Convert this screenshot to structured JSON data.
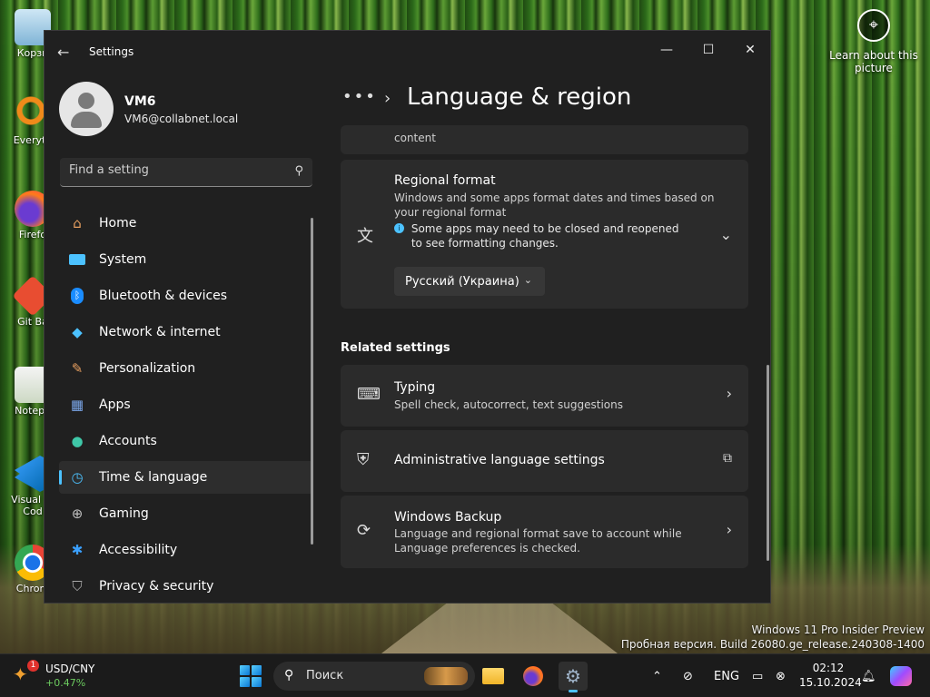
{
  "desktop": {
    "icons": [
      {
        "label": "Корзи",
        "icon": "recycle-bin-icon"
      },
      {
        "label": "Everyth",
        "icon": "everything-search-icon"
      },
      {
        "label": "Firefo",
        "icon": "firefox-icon"
      },
      {
        "label": "Git Ba",
        "icon": "git-bash-icon"
      },
      {
        "label": "Notepa",
        "icon": "notepad-plus-plus-icon"
      },
      {
        "label": "Visual St Cod",
        "icon": "vscode-icon"
      },
      {
        "label": "Chrom",
        "icon": "chrome-icon"
      }
    ],
    "learn_about": "Learn about this picture",
    "watermark_line1": "Windows 11 Pro Insider Preview",
    "watermark_line2": "Пробная версия. Build 26080.ge_release.240308-1400"
  },
  "window": {
    "title": "Settings",
    "controls": {
      "minimize": "—",
      "maximize": "☐",
      "close": "✕"
    }
  },
  "user": {
    "name": "VM6",
    "email": "VM6@collabnet.local"
  },
  "search": {
    "placeholder": "Find a setting"
  },
  "nav": {
    "items": [
      {
        "label": "Home",
        "icon": "home-icon",
        "color": "#e8a060"
      },
      {
        "label": "System",
        "icon": "monitor-icon",
        "color": "#4cc2ff"
      },
      {
        "label": "Bluetooth & devices",
        "icon": "bluetooth-icon",
        "color": "#1a8cff"
      },
      {
        "label": "Network & internet",
        "icon": "wifi-icon",
        "color": "#4cc2ff"
      },
      {
        "label": "Personalization",
        "icon": "brush-icon",
        "color": "#e8a060"
      },
      {
        "label": "Apps",
        "icon": "apps-icon",
        "color": "#7aa6e8"
      },
      {
        "label": "Accounts",
        "icon": "person-icon",
        "color": "#3fc8a8"
      },
      {
        "label": "Time & language",
        "icon": "globe-clock-icon",
        "color": "#4cc2ff",
        "active": true
      },
      {
        "label": "Gaming",
        "icon": "gamepad-icon",
        "color": "#bfbfbf"
      },
      {
        "label": "Accessibility",
        "icon": "accessibility-icon",
        "color": "#3aa0ff"
      },
      {
        "label": "Privacy & security",
        "icon": "shield-icon",
        "color": "#a8a8a8"
      }
    ]
  },
  "main": {
    "breadcrumb_dots": "•••",
    "page_title": "Language & region",
    "partial_card_text": "content",
    "regional": {
      "title": "Regional format",
      "desc": "Windows and some apps format dates and times based on your regional format",
      "info": "Some apps may need to be closed and reopened to see formatting changes.",
      "selected": "Русский (Украина)"
    },
    "related_heading": "Related settings",
    "related": [
      {
        "title": "Typing",
        "desc": "Spell check, autocorrect, text suggestions",
        "icon": "keyboard-icon",
        "action": "chevron"
      },
      {
        "title": "Administrative language settings",
        "desc": "",
        "icon": "admin-language-icon",
        "action": "external"
      },
      {
        "title": "Windows Backup",
        "desc": "Language and regional format save to account while Language preferences is checked.",
        "icon": "backup-sync-icon",
        "action": "chevron"
      }
    ]
  },
  "taskbar": {
    "widget_name": "USD/CNY",
    "widget_value": "+0.47%",
    "widget_badge": "1",
    "search_label": "Поиск",
    "lang": "ENG",
    "time": "02:12",
    "date": "15.10.2024"
  }
}
